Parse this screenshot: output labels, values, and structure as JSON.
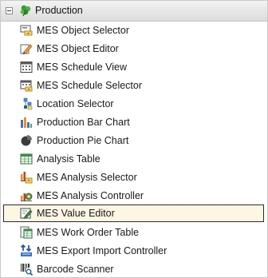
{
  "group": {
    "title": "Production",
    "icon": "production-leaf-icon",
    "expanded": true
  },
  "items": [
    {
      "label": "MES Object Selector",
      "icon": "object-selector-icon"
    },
    {
      "label": "MES Object Editor",
      "icon": "object-editor-icon"
    },
    {
      "label": "MES Schedule View",
      "icon": "schedule-view-icon"
    },
    {
      "label": "MES Schedule Selector",
      "icon": "schedule-selector-icon"
    },
    {
      "label": "Location Selector",
      "icon": "location-selector-icon"
    },
    {
      "label": "Production Bar Chart",
      "icon": "bar-chart-icon"
    },
    {
      "label": "Production Pie Chart",
      "icon": "pie-chart-icon"
    },
    {
      "label": "Analysis Table",
      "icon": "analysis-table-icon"
    },
    {
      "label": "MES Analysis Selector",
      "icon": "analysis-selector-icon"
    },
    {
      "label": "MES Analysis Controller",
      "icon": "analysis-controller-icon"
    },
    {
      "label": "MES Value Editor",
      "icon": "value-editor-icon",
      "selected": true
    },
    {
      "label": "MES Work Order Table",
      "icon": "work-order-table-icon"
    },
    {
      "label": "MES Export Import Controller",
      "icon": "export-import-icon"
    },
    {
      "label": "Barcode Scanner",
      "icon": "barcode-scanner-icon"
    }
  ],
  "colors": {
    "header_bg": "#e4e4e4",
    "selected_bg": "#fcf6e3",
    "selected_border": "#2b2b2b",
    "leaf_green": "#3f9a3a"
  }
}
